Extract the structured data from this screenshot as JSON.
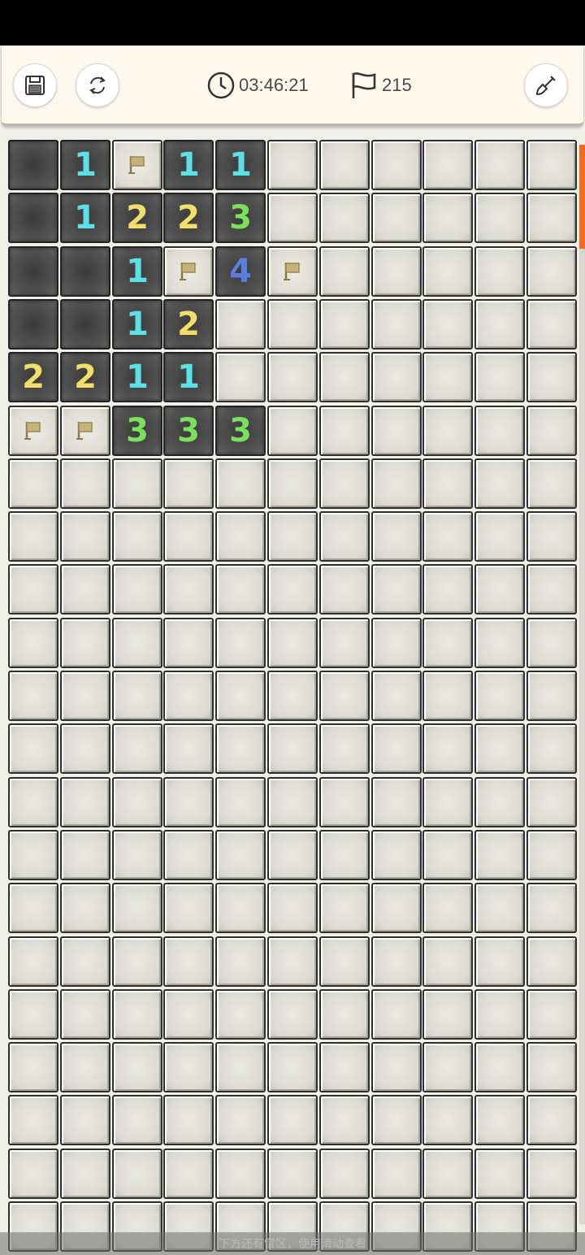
{
  "toolbar": {
    "save_icon": "save-icon",
    "restart_icon": "refresh-icon",
    "timer_icon": "clock-icon",
    "timer": "03:46:21",
    "flag_icon": "flag-icon",
    "flags_remaining": "215",
    "shovel_icon": "shovel-icon"
  },
  "colors": {
    "one": "#5ce1e6",
    "two": "#f2df6b",
    "three": "#7be15a",
    "four": "#5b7fe0",
    "scroll_accent": "#f26b21"
  },
  "board": {
    "columns": 11,
    "visible_rows": 21,
    "rows": [
      [
        "R",
        "1",
        "F",
        "1",
        "1",
        "H",
        "H",
        "H",
        "H",
        "H",
        "H"
      ],
      [
        "R",
        "1",
        "2",
        "2",
        "3",
        "H",
        "H",
        "H",
        "H",
        "H",
        "H"
      ],
      [
        "R",
        "R",
        "1",
        "F",
        "4",
        "F",
        "H",
        "H",
        "H",
        "H",
        "H"
      ],
      [
        "R",
        "R",
        "1",
        "2",
        "H",
        "H",
        "H",
        "H",
        "H",
        "H",
        "H"
      ],
      [
        "2",
        "2",
        "1",
        "1",
        "H",
        "H",
        "H",
        "H",
        "H",
        "H",
        "H"
      ],
      [
        "F",
        "F",
        "3",
        "3",
        "3",
        "H",
        "H",
        "H",
        "H",
        "H",
        "H"
      ],
      [
        "H",
        "H",
        "H",
        "H",
        "H",
        "H",
        "H",
        "H",
        "H",
        "H",
        "H"
      ],
      [
        "H",
        "H",
        "H",
        "H",
        "H",
        "H",
        "H",
        "H",
        "H",
        "H",
        "H"
      ],
      [
        "H",
        "H",
        "H",
        "H",
        "H",
        "H",
        "H",
        "H",
        "H",
        "H",
        "H"
      ],
      [
        "H",
        "H",
        "H",
        "H",
        "H",
        "H",
        "H",
        "H",
        "H",
        "H",
        "H"
      ],
      [
        "H",
        "H",
        "H",
        "H",
        "H",
        "H",
        "H",
        "H",
        "H",
        "H",
        "H"
      ],
      [
        "H",
        "H",
        "H",
        "H",
        "H",
        "H",
        "H",
        "H",
        "H",
        "H",
        "H"
      ],
      [
        "H",
        "H",
        "H",
        "H",
        "H",
        "H",
        "H",
        "H",
        "H",
        "H",
        "H"
      ],
      [
        "H",
        "H",
        "H",
        "H",
        "H",
        "H",
        "H",
        "H",
        "H",
        "H",
        "H"
      ],
      [
        "H",
        "H",
        "H",
        "H",
        "H",
        "H",
        "H",
        "H",
        "H",
        "H",
        "H"
      ],
      [
        "H",
        "H",
        "H",
        "H",
        "H",
        "H",
        "H",
        "H",
        "H",
        "H",
        "H"
      ],
      [
        "H",
        "H",
        "H",
        "H",
        "H",
        "H",
        "H",
        "H",
        "H",
        "H",
        "H"
      ],
      [
        "H",
        "H",
        "H",
        "H",
        "H",
        "H",
        "H",
        "H",
        "H",
        "H",
        "H"
      ],
      [
        "H",
        "H",
        "H",
        "H",
        "H",
        "H",
        "H",
        "H",
        "H",
        "H",
        "H"
      ],
      [
        "H",
        "H",
        "H",
        "H",
        "H",
        "H",
        "H",
        "H",
        "H",
        "H",
        "H"
      ],
      [
        "H",
        "H",
        "H",
        "H",
        "H",
        "H",
        "H",
        "H",
        "H",
        "H",
        "H"
      ]
    ]
  },
  "hint": "下方还有雷区，使用滑动查看"
}
